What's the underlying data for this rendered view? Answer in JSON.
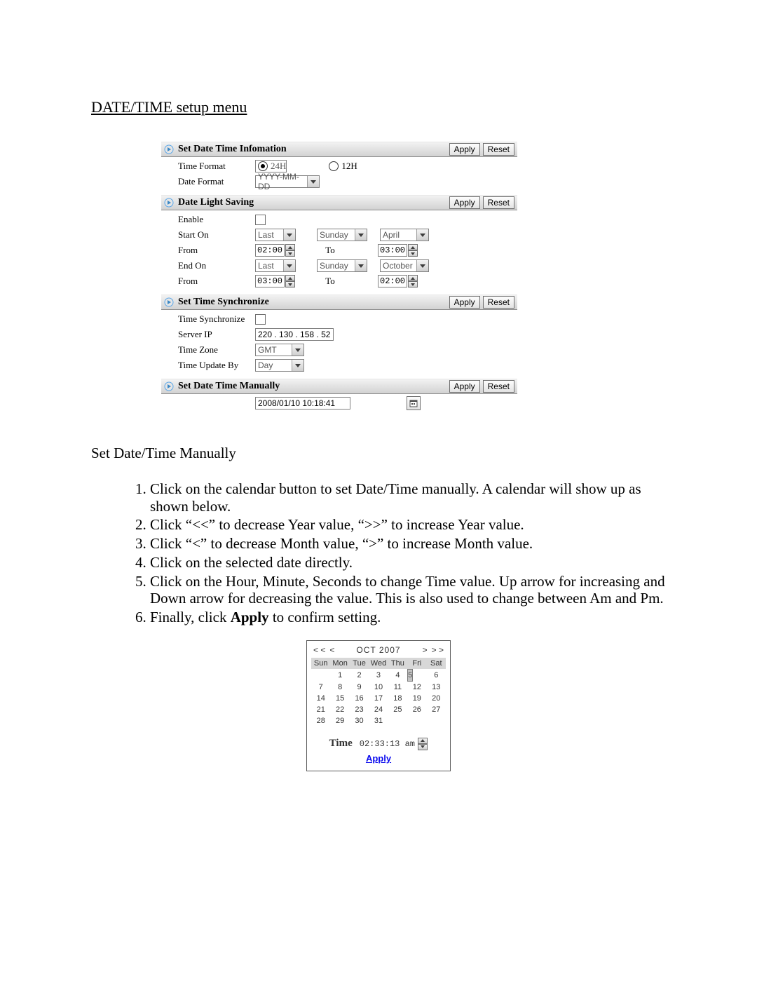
{
  "page_title": "DATE/TIME setup menu",
  "common_buttons": {
    "apply": "Apply",
    "reset": "Reset"
  },
  "sec1": {
    "title": "Set Date Time Infomation",
    "time_format_label": "Time Format",
    "time_format_24h": "24H",
    "time_format_12h": "12H",
    "date_format_label": "Date Format",
    "date_format_value": "YYYY-MM-DD"
  },
  "sec2": {
    "title": "Date Light Saving",
    "enable_label": "Enable",
    "start_label": "Start On",
    "start_week": "Last",
    "start_day": "Sunday",
    "start_month": "April",
    "from_label": "From",
    "from1_value": "02:00",
    "to_label": "To",
    "to1_value": "03:00",
    "end_label": "End On",
    "end_week": "Last",
    "end_day": "Sunday",
    "end_month": "October",
    "from2_value": "03:00",
    "to2_value": "02:00"
  },
  "sec3": {
    "title": "Set Time Synchronize",
    "sync_label": "Time Synchronize",
    "server_label": "Server IP",
    "server_value": "220 . 130 . 158 .  52",
    "tz_label": "Time Zone",
    "tz_value": "GMT",
    "update_label": "Time Update By",
    "update_value": "Day"
  },
  "sec4": {
    "title": "Set Date Time Manually",
    "datetime_value": "2008/01/10 10:18:41"
  },
  "manual": {
    "header": "Set Date/Time Manually",
    "steps": [
      "Click on the calendar button to set Date/Time manually. A calendar will show up as shown below.",
      "Click “<<” to decrease Year value, “>>” to increase Year value.",
      "Click “<” to decrease Month value, “>” to increase Month value.",
      "Click on the selected date directly.",
      "Click on the Hour, Minute, Seconds to change Time value. Up arrow for increasing and Down arrow for decreasing the value. This is also used to change between Am and Pm.",
      "Finally, click Apply to confirm setting."
    ],
    "apply_word": "Apply"
  },
  "calendar": {
    "nav_prev_year": "< <",
    "nav_prev_month": "<",
    "month_title": "OCT 2007",
    "nav_next_month": ">",
    "nav_next_year": "> >",
    "dow": [
      "Sun",
      "Mon",
      "Tue",
      "Wed",
      "Thu",
      "Fri",
      "Sat"
    ],
    "weeks": [
      [
        "",
        "1",
        "2",
        "3",
        "4",
        "5",
        "6"
      ],
      [
        "7",
        "8",
        "9",
        "10",
        "11",
        "12",
        "13"
      ],
      [
        "14",
        "15",
        "16",
        "17",
        "18",
        "19",
        "20"
      ],
      [
        "21",
        "22",
        "23",
        "24",
        "25",
        "26",
        "27"
      ],
      [
        "28",
        "29",
        "30",
        "31",
        "",
        "",
        ""
      ]
    ],
    "selected_day": "5",
    "time_label": "Time",
    "time_value": "02:33:13 am",
    "apply": "Apply"
  }
}
